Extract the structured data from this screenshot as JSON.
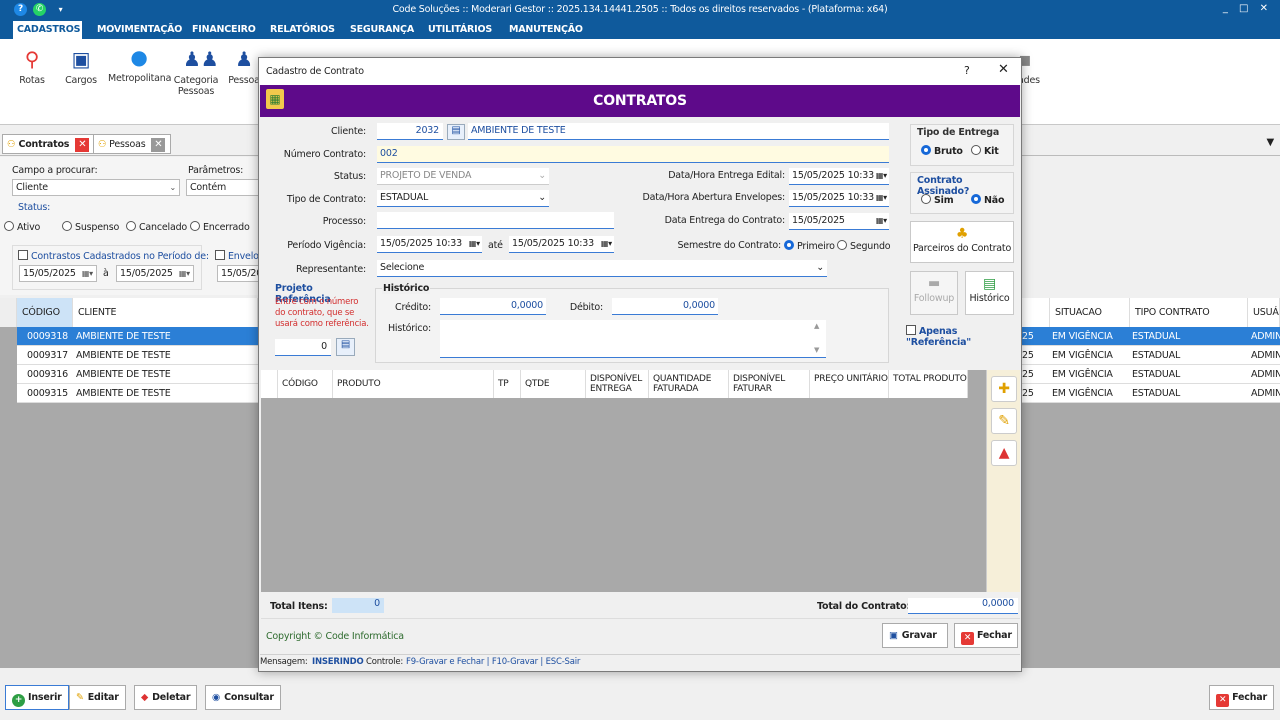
{
  "app": {
    "title": "Code Soluções :: Moderari Gestor :: 2025.134.14441.2505 :: Todos os direitos reservados - (Plataforma: x64)",
    "window_controls": "_ □ ✕"
  },
  "menu": [
    "CADASTROS",
    "MOVIMENTAÇÃO",
    "FINANCEIRO",
    "RELATÓRIOS",
    "SEGURANÇA",
    "UTILITÁRIOS",
    "MANUTENÇÃO"
  ],
  "ribbon": [
    {
      "label": "Rotas",
      "icon": "route-icon"
    },
    {
      "label": "Cargos",
      "icon": "id-card-icon"
    },
    {
      "label": "Metropolitana",
      "icon": "map-pin-icon"
    },
    {
      "label": "Categoria Pessoas",
      "icon": "people-group-icon"
    },
    {
      "label": "Pessoa",
      "icon": "person-icon"
    },
    {
      "label": "ades",
      "icon": "misc-icon"
    }
  ],
  "doc_tabs": [
    {
      "label": "Contratos",
      "close": "✕"
    },
    {
      "label": "Pessoas",
      "close": "✕"
    }
  ],
  "search": {
    "field_label": "Campo a procurar:",
    "field_value": "Cliente",
    "param_label": "Parâmetros:",
    "param_value": "Contém",
    "status_label": "Status:",
    "status_options": [
      "Ativo",
      "Suspenso",
      "Cancelado",
      "Encerrado"
    ],
    "period_label": "Contrastos Cadastrados no Período de:",
    "period_from": "15/05/2025",
    "period_sep": "à",
    "period_to": "15/05/2025",
    "envelope_label": "Envelop",
    "envelope_from": "15/05/20"
  },
  "grid": {
    "headers_left": [
      "CÓDIGO",
      "CLIENTE"
    ],
    "headers_right": [
      "SITUACAO",
      "TIPO CONTRATO",
      "USUÁ"
    ],
    "rows": [
      {
        "codigo": "0009318",
        "cliente": "AMBIENTE DE TESTE",
        "frag": "25",
        "situacao": "EM VIGÊNCIA",
        "tipo": "ESTADUAL",
        "usuario": "ADMIN"
      },
      {
        "codigo": "0009317",
        "cliente": "AMBIENTE DE TESTE",
        "frag": "25",
        "situacao": "EM VIGÊNCIA",
        "tipo": "ESTADUAL",
        "usuario": "ADMIN"
      },
      {
        "codigo": "0009316",
        "cliente": "AMBIENTE DE TESTE",
        "frag": "25",
        "situacao": "EM VIGÊNCIA",
        "tipo": "ESTADUAL",
        "usuario": "ADMIN"
      },
      {
        "codigo": "0009315",
        "cliente": "AMBIENTE DE TESTE",
        "frag": "25",
        "situacao": "EM VIGÊNCIA",
        "tipo": "ESTADUAL",
        "usuario": "ADMIN"
      }
    ]
  },
  "bottom": {
    "inserir": "Inserir",
    "editar": "Editar",
    "deletar": "Deletar",
    "consultar": "Consultar",
    "fechar": "Fechar"
  },
  "modal": {
    "title": "Cadastro de Contrato",
    "help": "?",
    "close": "✕",
    "header": "CONTRATOS",
    "cliente_label": "Cliente:",
    "cliente_code": "2032",
    "cliente_name": "AMBIENTE DE TESTE",
    "numero_label": "Número Contrato:",
    "numero_value": "002",
    "status_label": "Status:",
    "status_value": "PROJETO DE VENDA",
    "tipo_label": "Tipo de Contrato:",
    "tipo_value": "ESTADUAL",
    "processo_label": "Processo:",
    "processo_value": "",
    "vigencia_label": "Período Vigência:",
    "vigencia_from": "15/05/2025 10:33",
    "vigencia_sep": "até",
    "vigencia_to": "15/05/2025 10:33",
    "representante_label": "Representante:",
    "representante_value": "Selecione",
    "entrega_edital_label": "Data/Hora Entrega Edital:",
    "entrega_edital_value": "15/05/2025 10:33",
    "abertura_label": "Data/Hora Abertura Envelopes:",
    "abertura_value": "15/05/2025 10:33",
    "entrega_contrato_label": "Data Entrega do Contrato:",
    "entrega_contrato_value": "15/05/2025",
    "semestre_label": "Semestre do Contrato:",
    "semestre_options": [
      "Primeiro",
      "Segundo"
    ],
    "tipo_entrega_title": "Tipo de Entrega",
    "tipo_entrega_options": [
      "Bruto",
      "Kit"
    ],
    "assinado_title": "Contrato Assinado?",
    "assinado_options": [
      "Sim",
      "Não"
    ],
    "parceiros_label": "Parceiros do Contrato",
    "followup_label": "Followup",
    "historico_btn_label": "Histórico",
    "apenas_label": "Apenas \"Referência\"",
    "projeto_title": "Projeto Referência",
    "projeto_help": "Entre com o número do contrato, que se usará como referência.",
    "projeto_value": "0",
    "historico_title": "Histórico",
    "credito_label": "Crédito:",
    "credito_value": "0,0000",
    "debito_label": "Débito:",
    "debito_value": "0,0000",
    "historico_label": "Histórico:",
    "prod_headers": [
      "CÓDIGO",
      "PRODUTO",
      "TP",
      "QTDE",
      "DISPONÍVEL ENTREGA",
      "QUANTIDADE FATURADA",
      "DISPONÍVEL FATURAR",
      "PREÇO UNITÁRIO",
      "TOTAL PRODUTO"
    ],
    "total_itens_label": "Total Itens:",
    "total_itens_value": "0",
    "total_contrato_label": "Total do Contrato:",
    "total_contrato_value": "0,0000",
    "copyright": "Copyright © Code Informática",
    "gravar": "Gravar",
    "fechar": "Fechar",
    "status_msg_label": "Mensagem:",
    "status_msg_value": "INSERINDO",
    "status_ctrl_label": "Controle:",
    "status_ctrl_value": "F9-Gravar e Fechar | F10-Gravar | ESC-Sair"
  }
}
